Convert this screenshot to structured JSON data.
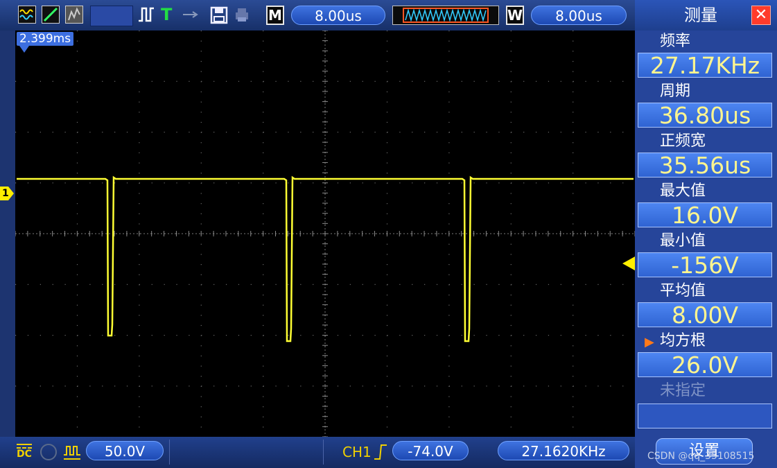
{
  "topbar": {
    "main_timebase_badge": "M",
    "main_timebase": "8.00us",
    "window_timebase_badge": "W",
    "window_timebase": "8.00us",
    "trigger_label": "T"
  },
  "screen": {
    "time_marker": "2.399ms",
    "channel_marker": "1"
  },
  "panel": {
    "title": "测量",
    "close": "✕",
    "measurements": [
      {
        "label": "频率",
        "value": "27.17KHz"
      },
      {
        "label": "周期",
        "value": "36.80us"
      },
      {
        "label": "正频宽",
        "value": "35.56us"
      },
      {
        "label": "最大值",
        "value": "16.0V"
      },
      {
        "label": "最小值",
        "value": "-156V"
      },
      {
        "label": "平均值",
        "value": "8.00V"
      },
      {
        "label": "均方根",
        "value": "26.0V",
        "selected": true
      },
      {
        "label": "未指定",
        "value": ""
      }
    ],
    "selected_marker": "▶",
    "settings": "设置"
  },
  "bottombar": {
    "coupling": "DC",
    "volts_per_div": "50.0V",
    "trigger_channel": "CH1",
    "trigger_level": "-74.0V",
    "frequency": "27.1620KHz"
  },
  "watermark": "CSDN @qq_35108515",
  "colors": {
    "trace": "#ffff33",
    "grid": "#6a6a6a",
    "pill": "#2f63d2",
    "close": "#ff3b2b"
  }
}
